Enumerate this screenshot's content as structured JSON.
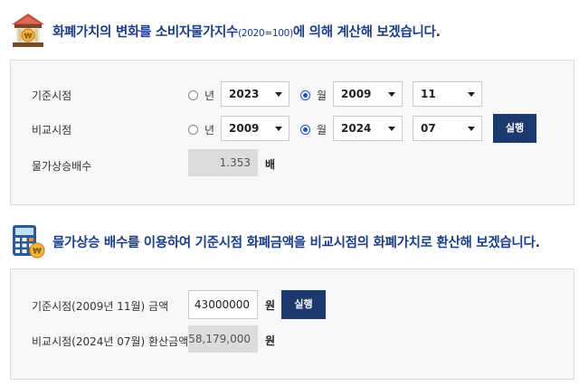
{
  "section1": {
    "title": "화폐가치의 변화를 소비자물가지수",
    "title_sub": "(2020=100)",
    "title_tail": "에 의해 계산해 보겠습니다."
  },
  "base_point": {
    "label": "기준시점",
    "year_radio_label": "년",
    "year_value": "2023",
    "month_radio_label": "월",
    "month_year_value": "2009",
    "month_value": "11",
    "selected": "month"
  },
  "compare_point": {
    "label": "비교시점",
    "year_radio_label": "년",
    "year_value": "2009",
    "month_radio_label": "월",
    "month_year_value": "2024",
    "month_value": "07",
    "selected": "month",
    "run_label": "실행"
  },
  "inflation": {
    "label": "물가상승배수",
    "value": "1.353",
    "unit": "배"
  },
  "section2": {
    "title": "물가상승 배수를 이용하여 기준시점 화폐금액을 비교시점의 화폐가치로 환산해 보겠습니다."
  },
  "base_amount": {
    "label": "기준시점(2009년 11월) 금액",
    "value": "43000000",
    "unit": "원",
    "run_label": "실행"
  },
  "converted_amount": {
    "label": "비교시점(2024년 07월) 환산금액",
    "value": "58,179,000",
    "unit": "원"
  },
  "colors": {
    "title": "#1a3d86",
    "button": "#1c3a6f",
    "radio_selected": "#1a55c7",
    "panel_bg": "#f7f7f7"
  },
  "icons": {
    "section1": "bank-coin-icon",
    "section2": "calculator-coin-icon"
  }
}
